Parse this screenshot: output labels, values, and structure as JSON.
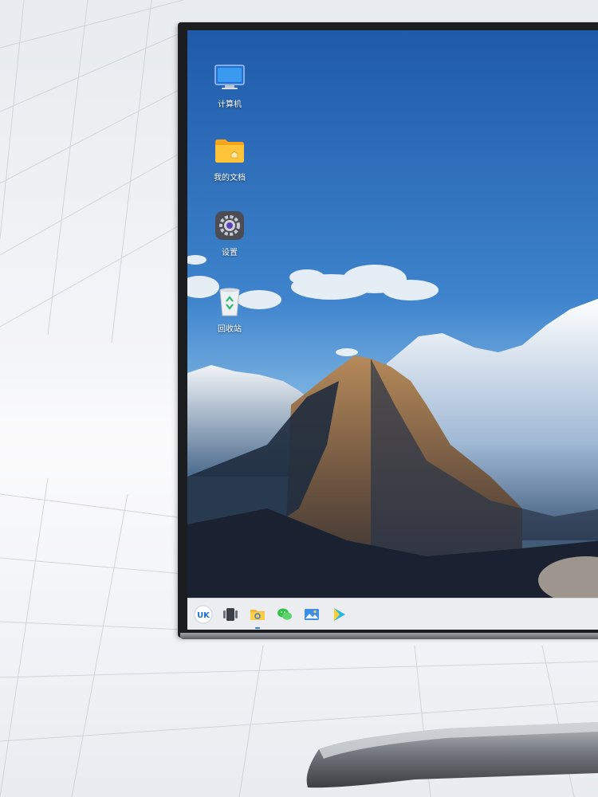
{
  "desktop": {
    "icons": [
      {
        "label": "计算机",
        "icon": "computer-icon"
      },
      {
        "label": "我的文档",
        "icon": "folder-icon"
      },
      {
        "label": "设置",
        "icon": "settings-icon"
      },
      {
        "label": "回收站",
        "icon": "recycle-bin-icon"
      }
    ]
  },
  "taskbar": {
    "items": [
      {
        "icon": "start-menu-uk-icon",
        "text": "UK"
      },
      {
        "icon": "multitask-view-icon"
      },
      {
        "icon": "file-manager-icon"
      },
      {
        "icon": "wechat-icon"
      },
      {
        "icon": "image-viewer-icon"
      },
      {
        "icon": "video-player-icon"
      }
    ]
  },
  "colors": {
    "sky_top": "#1f5fb0",
    "sky_bottom": "#6aa8df",
    "taskbar": "#ebedf1",
    "bezel": "#1b1d20",
    "accent": "#2b7cd9"
  }
}
